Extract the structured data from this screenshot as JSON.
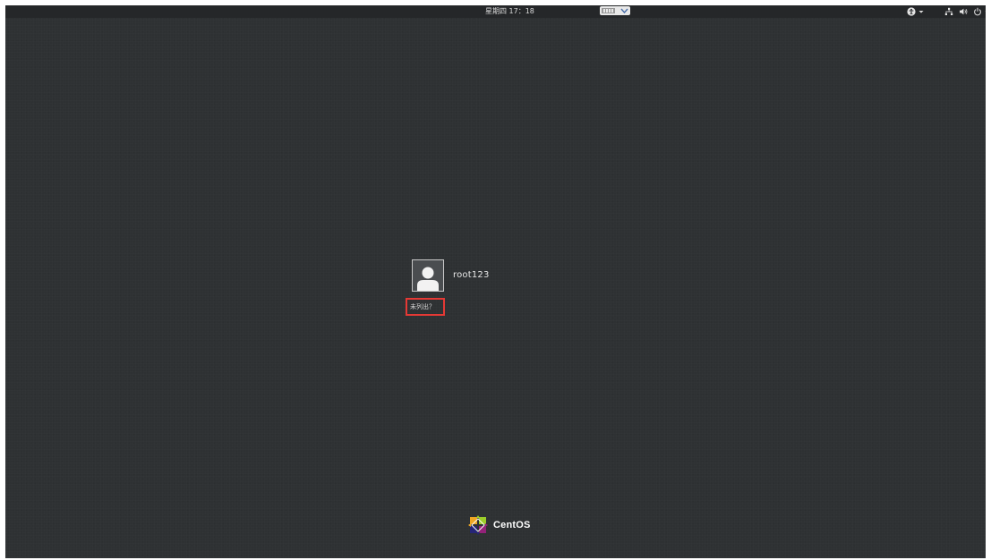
{
  "topbar": {
    "clock": "星期四 17：18",
    "input_indicator_icon": "keyboard-layout-icon",
    "tray_icons": [
      "accessibility-icon",
      "network-icon",
      "volume-icon",
      "power-icon"
    ]
  },
  "login": {
    "users": [
      {
        "name": "root123",
        "avatar_icon": "user-avatar-icon"
      }
    ],
    "not_listed_label": "未列出？"
  },
  "branding": {
    "name": "CentOS",
    "logo_icon": "centos-logo-icon"
  },
  "colors": {
    "background": "#2e3133",
    "topbar": "#252729",
    "highlight_box": "#e53935",
    "text": "#e6e6e6"
  }
}
